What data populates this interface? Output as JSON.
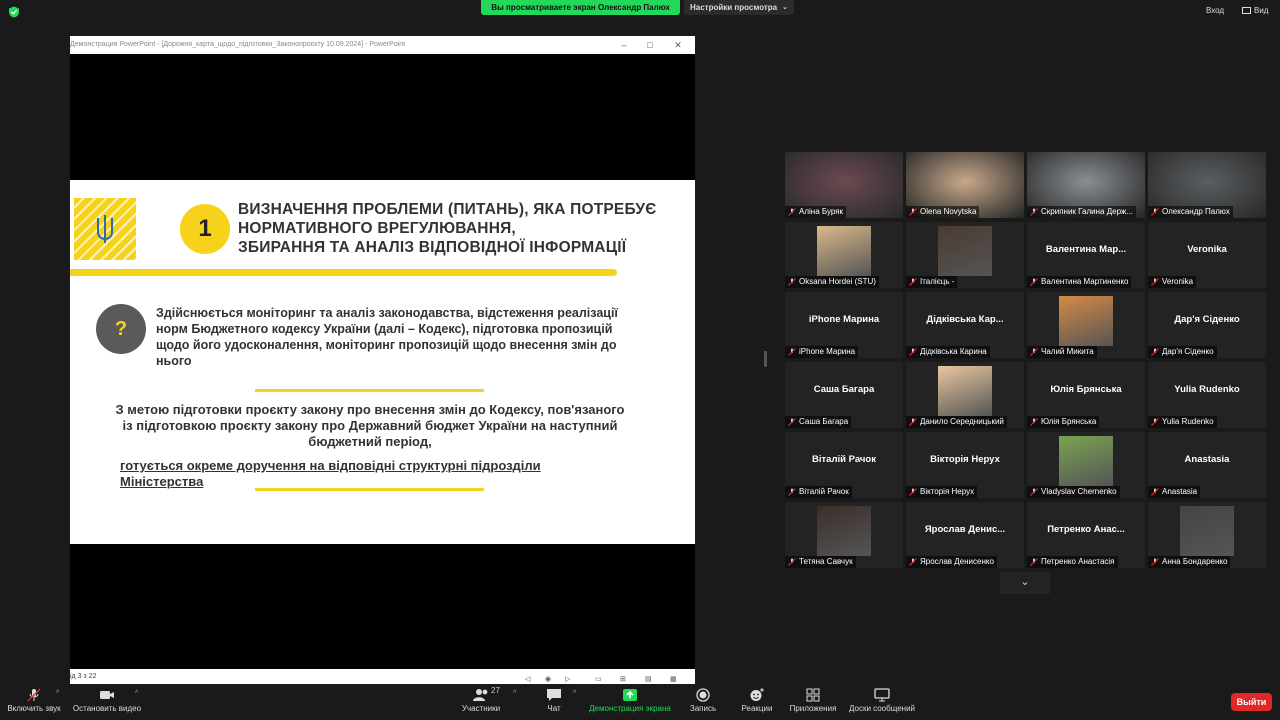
{
  "top_bar": {
    "share_banner": "Вы просматриваете экран Олександр Палюх",
    "view_settings": "Настройки просмотра",
    "exit": "Вход",
    "view": "Вид"
  },
  "shared_window": {
    "title": "Демонстрация PowerPoint - [Дорожня_карта_щодо_підготовки_Законопроєкту 10.09.2024] - PowerPoint",
    "status_slide": "ід 3 з 22",
    "slide": {
      "number": "1",
      "heading": [
        "ВИЗНАЧЕННЯ ПРОБЛЕМИ (ПИТАНЬ), ЯКА ПОТРЕБУЄ",
        "НОРМАТИВНОГО ВРЕГУЛЮВАННЯ,",
        "ЗБИРАННЯ ТА АНАЛІЗ ВІДПОВІДНОЇ ІНФОРМАЦІЇ"
      ],
      "question_mark": "?",
      "paragraph": "Здійснюється моніторинг та аналіз законодавства, відстеження реалізації норм Бюджетного кодексу України (далі – Кодекс), підготовка пропозицій щодо його удосконалення, моніторинг пропозицій щодо внесення змін до нього",
      "center_text": "З метою підготовки проєкту закону про внесення змін до Кодексу, пов'язаного із підготовкою проєкту закону про Державний бюджет України на наступний бюджетний період,",
      "underlined_text": "готується окреме доручення на відповідні структурні підрозділи Міністерства"
    }
  },
  "participants": [
    {
      "label": "Аліна Буряк",
      "big": "",
      "kind": "photo",
      "tone": "#6b4a52"
    },
    {
      "label": "Olena Novytska",
      "big": "",
      "kind": "photo",
      "tone": "#c9a98b"
    },
    {
      "label": "Скрипник Галина Держ...",
      "big": "",
      "kind": "photo",
      "tone": "#8a8f94"
    },
    {
      "label": "Олександр Палюх",
      "big": "",
      "kind": "photo",
      "tone": "#5b5f62",
      "active": true
    },
    {
      "label": "Oksana Hordei (STU)",
      "big": "",
      "kind": "avatar",
      "tone": "#d9b98a"
    },
    {
      "label": "Італієць -",
      "big": "",
      "kind": "avatar",
      "tone": "#4a3a30"
    },
    {
      "label": "Валентина Мартиненко",
      "big": "Валентина  Мар...",
      "kind": "name"
    },
    {
      "label": "Veronika",
      "big": "Veronika",
      "kind": "name"
    },
    {
      "label": "iPhone Марина",
      "big": "iPhone Марина",
      "kind": "name"
    },
    {
      "label": "Дідківська Карина",
      "big": "Дідківська  Кар...",
      "kind": "name"
    },
    {
      "label": "Чалий Микита",
      "big": "",
      "kind": "avatar",
      "tone": "#d68a45"
    },
    {
      "label": "Дар'я Сіденко",
      "big": "Дар'я Сіденко",
      "kind": "name"
    },
    {
      "label": "Саша Багара",
      "big": "Саша Багара",
      "kind": "name"
    },
    {
      "label": "Данило Середницький",
      "big": "",
      "kind": "avatar",
      "tone": "#e9c7a0"
    },
    {
      "label": "Юлія Брянська",
      "big": "Юлія Брянська",
      "kind": "name"
    },
    {
      "label": "Yulia Rudenko",
      "big": "Yulia Rudenko",
      "kind": "name"
    },
    {
      "label": "Віталій Рачок",
      "big": "Віталій Рачок",
      "kind": "name"
    },
    {
      "label": "Вікторія Нерух",
      "big": "Вікторія Нерух",
      "kind": "name"
    },
    {
      "label": "Vladyslav Chernenko",
      "big": "",
      "kind": "avatar",
      "tone": "#7aa352"
    },
    {
      "label": "Anastasia",
      "big": "Anastasia",
      "kind": "name"
    },
    {
      "label": "Тетяна Савчук",
      "big": "",
      "kind": "avatar",
      "tone": "#3b2e2a"
    },
    {
      "label": "Ярослав Денисенко",
      "big": "Ярослав  Денис...",
      "kind": "name"
    },
    {
      "label": "Петренко Анастасія",
      "big": "Петренко  Анас...",
      "kind": "name"
    },
    {
      "label": "Анна Бондаренко",
      "big": "",
      "kind": "avatar",
      "tone": "#444"
    }
  ],
  "toolbar": {
    "audio": "Включить звук",
    "video": "Остановить видео",
    "participants": "Участники",
    "participants_count": "27",
    "chat": "Чат",
    "share": "Демонстрация экрана",
    "record": "Запись",
    "reactions": "Реакции",
    "apps": "Приложения",
    "whiteboards": "Доски сообщений",
    "leave": "Выйти"
  },
  "colors": {
    "share_green": "#23d959",
    "slide_yellow": "#f7d21b",
    "active_speaker": "#b9e43c",
    "leave_red": "#e02828"
  }
}
